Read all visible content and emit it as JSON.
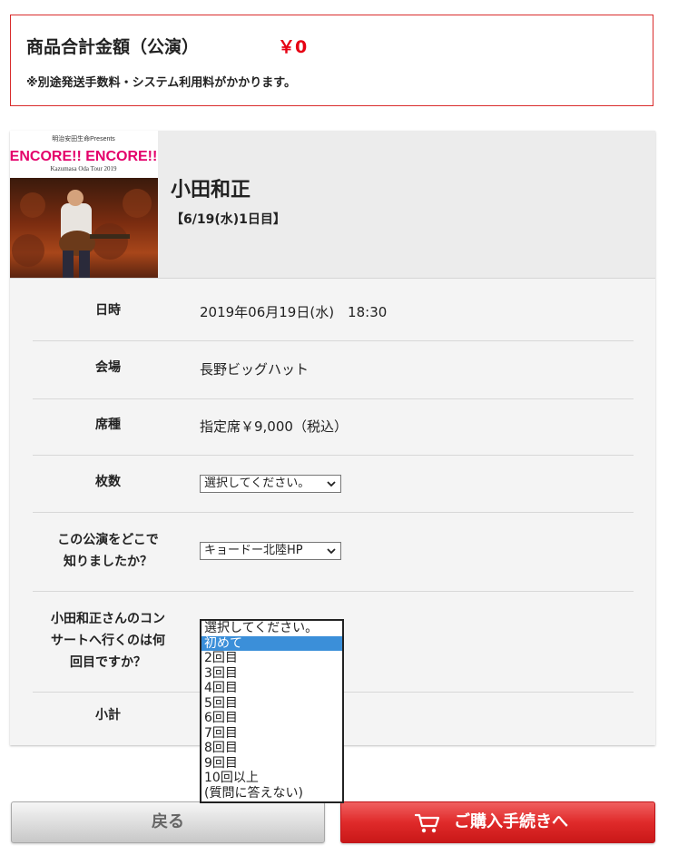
{
  "total": {
    "title": "商品合計金額（公演）",
    "amount": "￥0",
    "note": "※別途発送手数料・システム利用料がかかります。"
  },
  "event": {
    "artist": "小田和正",
    "date_label": "【6/19(水)1日目】",
    "thumbnail": {
      "line1": "明治安田生命Presents",
      "logo": "ENCORE!! ENCORE!!",
      "subtitle": "Kazumasa Oda Tour 2019"
    }
  },
  "details": {
    "datetime": {
      "label": "日時",
      "value": "2019年06月19日(水)　18:30"
    },
    "venue": {
      "label": "会場",
      "value": "長野ビッグハット"
    },
    "seat": {
      "label": "席種",
      "value": "指定席￥9,000（税込）"
    },
    "count": {
      "label": "枚数",
      "selected": "選択してください。"
    },
    "source": {
      "label_line1": "この公演をどこで",
      "label_line2": "知りましたか？",
      "selected": "キョードー北陸HP"
    },
    "visits": {
      "label_line1": "小田和正さんのコン",
      "label_line2": "サートへ行くのは何",
      "label_line3": "回目ですか？",
      "options": [
        "選択してください。",
        "初めて",
        "2回目",
        "3回目",
        "4回目",
        "5回目",
        "6回目",
        "7回目",
        "8回目",
        "9回目",
        "10回以上",
        "(質問に答えない)"
      ],
      "highlighted": "初めて"
    },
    "subtotal": {
      "label": "小計"
    }
  },
  "buttons": {
    "back": "戻る",
    "buy": "ご購入手続きへ"
  },
  "colors": {
    "accent_red": "#e60012",
    "selection_blue": "#3b8fd9"
  }
}
